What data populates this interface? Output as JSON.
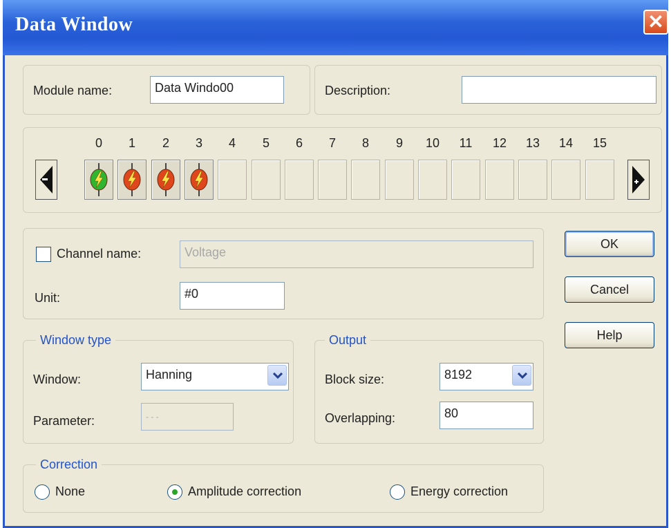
{
  "window": {
    "title": "Data Window",
    "close_icon": "close-icon"
  },
  "module": {
    "name_label": "Module name:",
    "name_value": "Data Windo00",
    "description_label": "Description:",
    "description_value": ""
  },
  "channels": {
    "numbers": [
      "0",
      "1",
      "2",
      "3",
      "4",
      "5",
      "6",
      "7",
      "8",
      "9",
      "10",
      "11",
      "12",
      "13",
      "14",
      "15"
    ],
    "slots": [
      {
        "state": "active",
        "icon": "lightning-bolt-icon",
        "color": "#2fb52f"
      },
      {
        "state": "active",
        "icon": "lightning-bolt-icon",
        "color": "#e0461c"
      },
      {
        "state": "active",
        "icon": "lightning-bolt-icon",
        "color": "#e0461c"
      },
      {
        "state": "active",
        "icon": "lightning-bolt-icon",
        "color": "#e0461c"
      },
      {
        "state": "empty"
      },
      {
        "state": "empty"
      },
      {
        "state": "empty"
      },
      {
        "state": "empty"
      },
      {
        "state": "empty"
      },
      {
        "state": "empty"
      },
      {
        "state": "empty"
      },
      {
        "state": "empty"
      },
      {
        "state": "empty"
      },
      {
        "state": "empty"
      },
      {
        "state": "empty"
      },
      {
        "state": "empty"
      }
    ]
  },
  "channel": {
    "name_label": "Channel name:",
    "name_value": "Voltage",
    "name_checked": false,
    "unit_label": "Unit:",
    "unit_value": "#0"
  },
  "buttons": {
    "ok": "OK",
    "cancel": "Cancel",
    "help": "Help"
  },
  "window_type": {
    "legend": "Window type",
    "window_label": "Window:",
    "window_value": "Hanning",
    "parameter_label": "Parameter:",
    "parameter_value": "- - -"
  },
  "output": {
    "legend": "Output",
    "block_size_label": "Block size:",
    "block_size_value": "8192",
    "overlapping_label": "Overlapping:",
    "overlapping_value": "80"
  },
  "correction": {
    "legend": "Correction",
    "options": [
      "None",
      "Amplitude correction",
      "Energy correction"
    ],
    "selected": "Amplitude correction"
  },
  "colors": {
    "title_bar": "#2458d4",
    "legend_text": "#2253c8",
    "dialog_bg": "#ece9d8"
  }
}
